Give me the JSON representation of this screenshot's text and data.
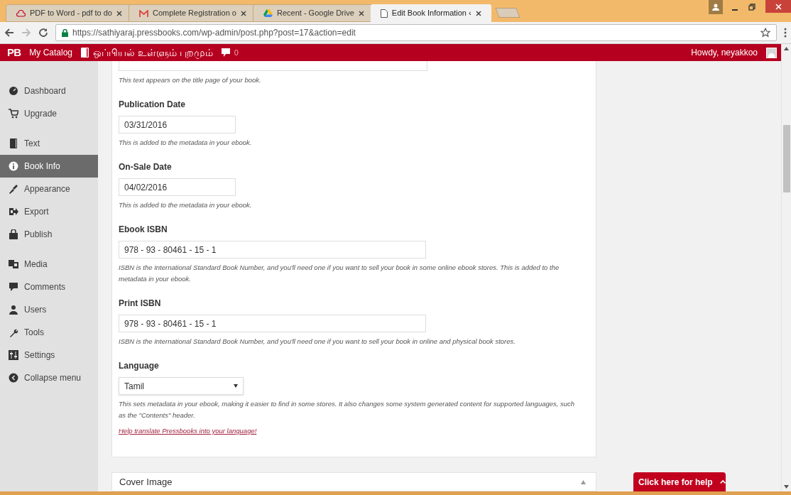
{
  "browser": {
    "tabs": [
      {
        "title": "PDF to Word - pdf to do",
        "selected": false
      },
      {
        "title": "Complete Registration o",
        "selected": false
      },
      {
        "title": "Recent - Google Drive",
        "selected": false
      },
      {
        "title": "Edit Book Information ‹",
        "selected": true
      }
    ],
    "url": "https://sathiyaraj.pressbooks.com/wp-admin/post.php?post=17&action=edit"
  },
  "admin_bar": {
    "logo": "PB",
    "catalog": "My Catalog",
    "book_title": "ஒப்பியல் உள்ளும் புறமும்",
    "comments": "0",
    "greeting": "Howdy, neyakkoo"
  },
  "sidebar": {
    "groups": [
      [
        {
          "label": "Dashboard",
          "selected": false
        },
        {
          "label": "Upgrade",
          "selected": false
        }
      ],
      [
        {
          "label": "Text",
          "selected": false
        },
        {
          "label": "Book Info",
          "selected": true
        },
        {
          "label": "Appearance",
          "selected": false
        },
        {
          "label": "Export",
          "selected": false
        },
        {
          "label": "Publish",
          "selected": false
        }
      ],
      [
        {
          "label": "Media",
          "selected": false
        },
        {
          "label": "Comments",
          "selected": false
        },
        {
          "label": "Users",
          "selected": false
        },
        {
          "label": "Tools",
          "selected": false
        },
        {
          "label": "Settings",
          "selected": false
        },
        {
          "label": "Collapse menu",
          "selected": false
        }
      ]
    ]
  },
  "form": {
    "fields": [
      {
        "kind": "partial",
        "hint": "This text appears on the title page of your book."
      },
      {
        "kind": "date",
        "label": "Publication Date",
        "value": "03/31/2016",
        "hint": "This is added to the metadata in your ebook."
      },
      {
        "kind": "date",
        "label": "On-Sale Date",
        "value": "04/02/2016",
        "hint": "This is added to the metadata in your ebook."
      },
      {
        "kind": "isbn",
        "label": "Ebook ISBN",
        "value": "978 - 93 - 80461 - 15 - 1",
        "hint": "ISBN is the International Standard Book Number, and you'll need one if you want to sell your book in some online ebook stores. This is added to the metadata in your ebook."
      },
      {
        "kind": "isbn",
        "label": "Print ISBN",
        "value": "978 - 93 - 80461 - 15 - 1",
        "hint": "ISBN is the International Standard Book Number, and you'll need one if you want to sell your book in online and physical book stores."
      },
      {
        "kind": "select",
        "label": "Language",
        "value": "Tamil",
        "hint": "This sets metadata in your ebook, making it easier to find in some stores. It also changes some system generated content for supported languages, such as the \"Contents\" header.",
        "link": "Help translate Pressbooks into your language!"
      }
    ]
  },
  "cover_panel": {
    "title": "Cover Image"
  },
  "help_button": {
    "label": "Click here for help"
  }
}
